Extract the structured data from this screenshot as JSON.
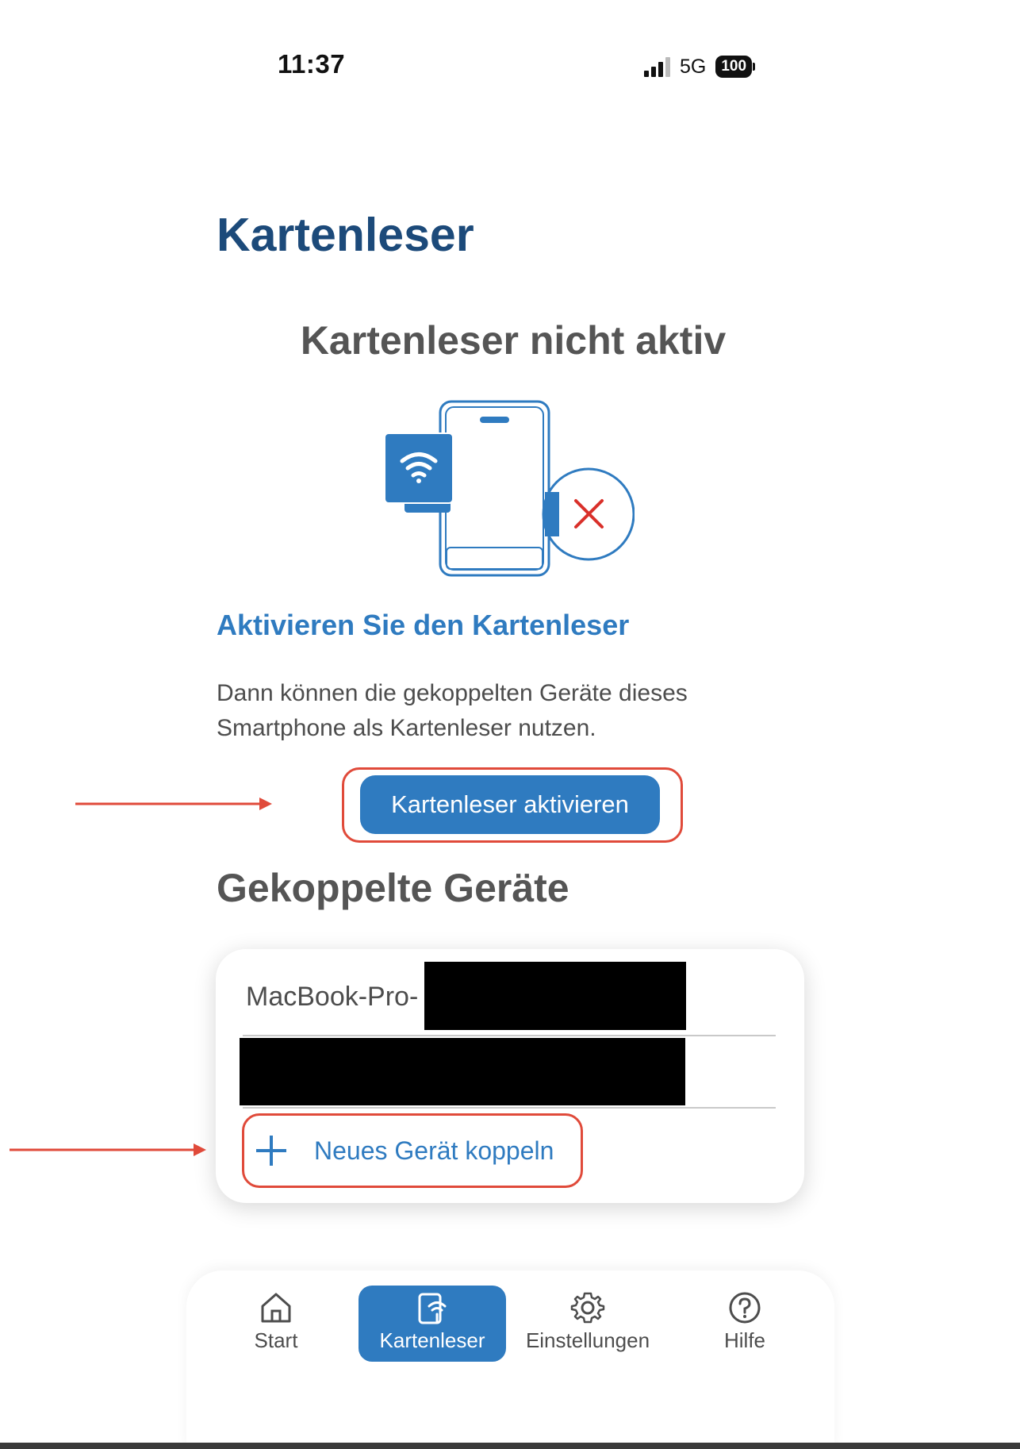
{
  "status_bar": {
    "time": "11:37",
    "network": "5G",
    "battery": "100"
  },
  "page": {
    "title": "Kartenleser",
    "state_title": "Kartenleser nicht aktiv",
    "activate_heading": "Aktivieren Sie den Kartenleser",
    "description": "Dann können die gekoppelten Geräte dieses Smartphone als Kartenleser nutzen.",
    "activate_button": "Kartenleser aktivieren"
  },
  "paired_devices": {
    "title": "Gekoppelte Geräte",
    "devices": [
      "MacBook-Pro-"
    ],
    "add_label": "Neues Gerät koppeln"
  },
  "tab_bar": {
    "tabs": [
      {
        "label": "Start",
        "icon": "home-icon",
        "active": false
      },
      {
        "label": "Kartenleser",
        "icon": "card-reader-icon",
        "active": true
      },
      {
        "label": "Einstellungen",
        "icon": "gear-icon",
        "active": false
      },
      {
        "label": "Hilfe",
        "icon": "help-icon",
        "active": false
      }
    ]
  },
  "colors": {
    "primary": "#2f7bc0",
    "title": "#1c4a7a",
    "annotation": "#e04a3a",
    "error": "#d9302a"
  }
}
